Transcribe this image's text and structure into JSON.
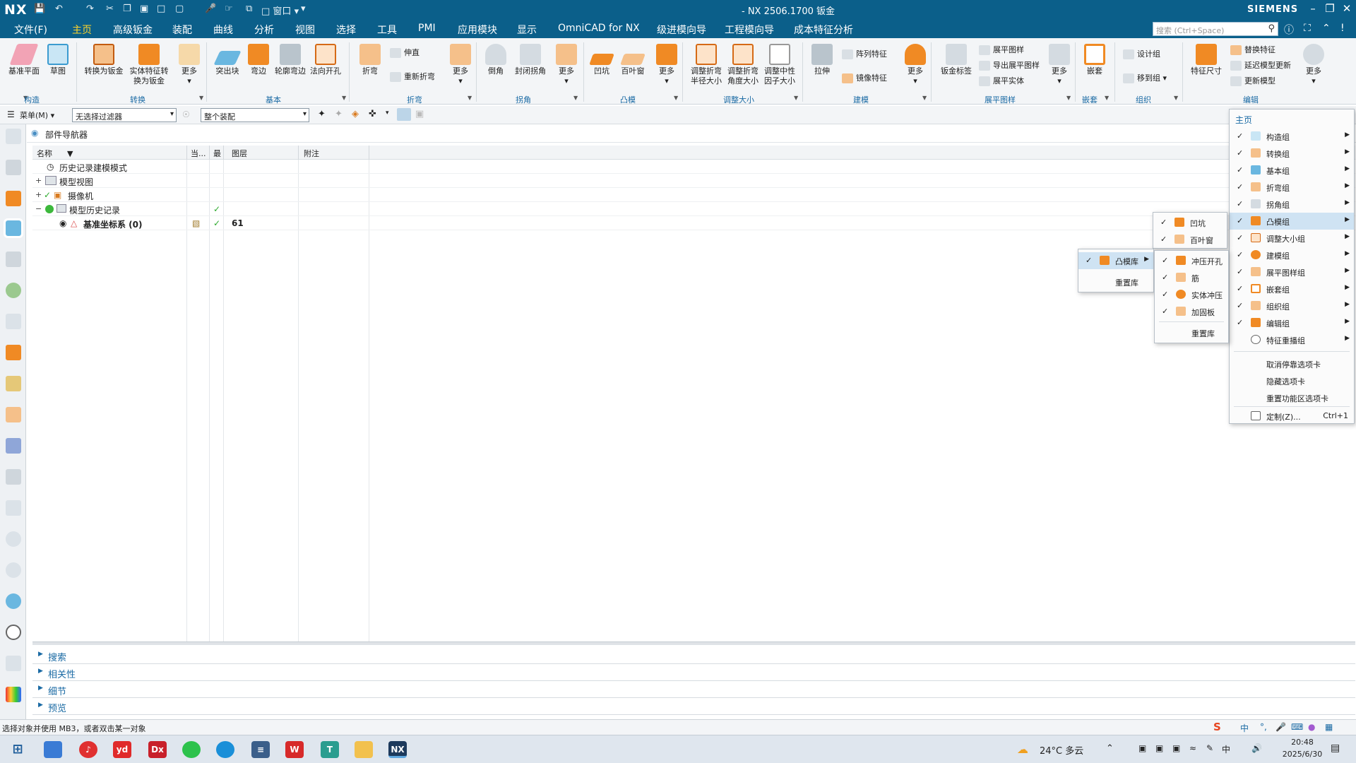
{
  "titlebar": {
    "logo": "NX",
    "title": "- NX 2506.1700 钣金",
    "brand": "SIEMENS",
    "window_menu": "窗口",
    "min": "–",
    "restore": "❐",
    "close": "✕"
  },
  "menubar": {
    "file": "文件(F)",
    "tabs": [
      "主页",
      "高级钣金",
      "装配",
      "曲线",
      "分析",
      "视图",
      "选择",
      "工具",
      "PMI",
      "应用模块",
      "显示",
      "OmniCAD for NX",
      "级进模向导",
      "工程模向导",
      "成本特征分析"
    ],
    "active_tab": "主页",
    "search_placeholder": "搜索 (Ctrl+Space)"
  },
  "ribbon": {
    "groups": {
      "construct": "构造",
      "convert": "转换",
      "basic": "基本",
      "fold": "折弯",
      "corner": "拐角",
      "punch": "凸模",
      "resize": "调整大小",
      "modeling": "建模",
      "flat": "展平图样",
      "nest": "嵌套",
      "organize": "组织",
      "edit": "编辑"
    },
    "buttons": {
      "datum_plane": "基准平面",
      "sketch": "草图",
      "convert_sm": "转换为钣金",
      "solid_convert_1": "实体特征转",
      "solid_convert_2": "换为钣金",
      "more": "更多",
      "tab": "突出块",
      "flange": "弯边",
      "contour_flange": "轮廓弯边",
      "normal_cutout": "法向开孔",
      "bend": "折弯",
      "unbend": "伸直",
      "rebend": "重新折弯",
      "chamfer": "倒角",
      "closed_corner": "封闭拐角",
      "dimple": "凹坑",
      "louver": "百叶窗",
      "resize_bend_r_1": "调整折弯",
      "resize_bend_r_2": "半径大小",
      "resize_bend_a_1": "调整折弯",
      "resize_bend_a_2": "角度大小",
      "resize_k_1": "调整中性",
      "resize_k_2": "因子大小",
      "extrude": "拉伸",
      "pattern": "阵列特征",
      "mirror": "镜像特征",
      "sm_tag": "钣金标签",
      "flat_pattern": "展平图样",
      "export_flat": "导出展平图样",
      "flat_solid": "展平实体",
      "nest": "嵌套",
      "design_group": "设计组",
      "move_to_group": "移到组",
      "feature_dim": "特征尺寸",
      "replace_feature": "替换特征",
      "delay_update": "延迟模型更新",
      "update_model": "更新模型"
    }
  },
  "toolrow": {
    "menu": "菜单(M)",
    "filter": "无选择过滤器",
    "scope": "整个装配"
  },
  "navigator": {
    "title": "部件导航器",
    "columns": [
      "名称",
      "当...",
      "最",
      "图层",
      "附注"
    ],
    "rows": [
      {
        "label": "历史记录建模模式",
        "layer": ""
      },
      {
        "label": "模型视图",
        "layer": ""
      },
      {
        "label": "摄像机",
        "layer": ""
      },
      {
        "label": "模型历史记录",
        "layer": ""
      },
      {
        "label": "基准坐标系 (0)",
        "layer": "61"
      }
    ]
  },
  "bottom_panels": [
    "搜索",
    "相关性",
    "细节",
    "预览"
  ],
  "status_text": "选择对象并使用 MB3，或者双击某一对象",
  "ribbon_menu": {
    "header": "主页",
    "items": [
      {
        "label": "构造组",
        "checked": true
      },
      {
        "label": "转换组",
        "checked": true
      },
      {
        "label": "基本组",
        "checked": true
      },
      {
        "label": "折弯组",
        "checked": true
      },
      {
        "label": "拐角组",
        "checked": true
      },
      {
        "label": "凸模组",
        "checked": true
      },
      {
        "label": "调整大小组",
        "checked": true
      },
      {
        "label": "建模组",
        "checked": true
      },
      {
        "label": "展平图样组",
        "checked": true
      },
      {
        "label": "嵌套组",
        "checked": true
      },
      {
        "label": "组织组",
        "checked": true
      },
      {
        "label": "编辑组",
        "checked": true
      },
      {
        "label": "特征重播组",
        "checked": false
      }
    ],
    "actions": [
      "取消停靠选项卡",
      "隐藏选项卡",
      "重置功能区选项卡"
    ],
    "customize": "定制(Z)...",
    "customize_shortcut": "Ctrl+1"
  },
  "punch_menu": {
    "items": [
      {
        "label": "凹坑",
        "checked": true
      },
      {
        "label": "百叶窗",
        "checked": true
      }
    ]
  },
  "punch_lib_menu": {
    "item": "凸模库",
    "reset": "重置库"
  },
  "punch_lib_sub": {
    "items": [
      {
        "label": "冲压开孔",
        "checked": true
      },
      {
        "label": "筋",
        "checked": true
      },
      {
        "label": "实体冲压",
        "checked": true
      },
      {
        "label": "加固板",
        "checked": true
      }
    ],
    "reset": "重置库"
  },
  "taskbar": {
    "weather": "24°C 多云",
    "ime": "中",
    "time": "20:48",
    "date": "2025/6/30"
  },
  "colors": {
    "title_bg": "#0b5f8a",
    "accent": "#ffd42a",
    "group_label": "#1a6aa4",
    "icon_orange": "#f08a24",
    "icon_pink": "#f2a3b5",
    "icon_blue": "#6ab7e0",
    "check_green": "#2eaa2e"
  }
}
